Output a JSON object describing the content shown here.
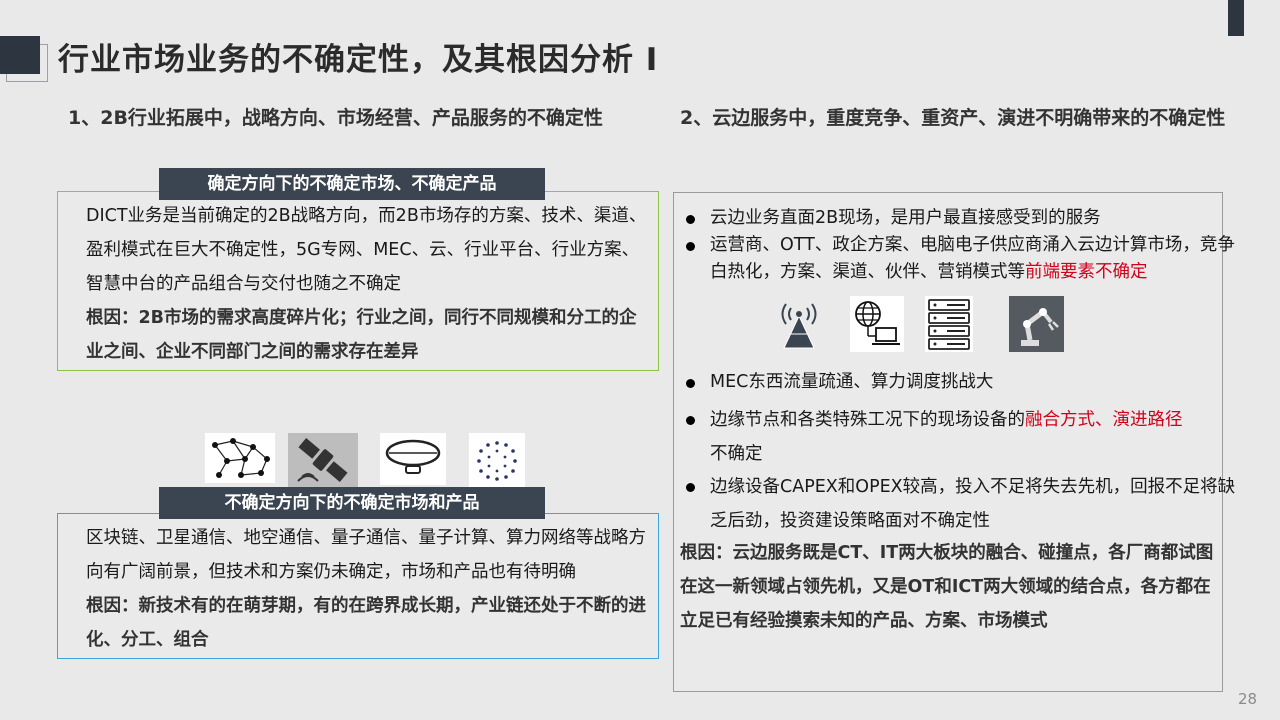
{
  "title": "行业市场业务的不确定性，及其根因分析 I",
  "left": {
    "heading": "1、2B行业拓展中，战略方向、市场经营、产品服务的不确定性",
    "section1": {
      "banner": "确定方向下的不确定市场、不确定产品",
      "body": "DICT业务是当前确定的2B战略方向，而2B市场存的方案、技术、渠道、盈利模式在巨大不确定性，5G专网、MEC、云、行业平台、行业方案、智慧中台的产品组合与交付也随之不确定",
      "root": "根因：2B市场的需求高度碎片化；行业之间，同行不同规模和分工的企业之间、企业不同部门之间的需求存在差异"
    },
    "icons": [
      "network-graph-icon",
      "satellite-icon",
      "airship-icon",
      "quantum-dots-icon"
    ],
    "section2": {
      "banner": "不确定方向下的不确定市场和产品",
      "body": "区块链、卫星通信、地空通信、量子通信、量子计算、算力网络等战略方向有广阔前景，但技术和方案仍未确定，市场和产品也有待明确",
      "root": "根因：新技术有的在萌芽期，有的在跨界成长期，产业链还处于不断的进化、分工、组合"
    }
  },
  "right": {
    "heading": "2、云边服务中，重度竞争、重资产、演进不明确带来的不确定性",
    "bullets_top": [
      {
        "text": "云边业务直面2B现场，是用户最直接感受到的服务",
        "red": ""
      },
      {
        "text": "运营商、OTT、政企方案、电脑电子供应商涌入云边计算市场，竞争白热化，方案、渠道、伙伴、营销模式等",
        "red": "前端要素不确定"
      }
    ],
    "icons": [
      "signal-tower-icon",
      "globe-computer-icon",
      "server-rack-icon",
      "robot-arm-icon"
    ],
    "bullets_bottom": [
      {
        "text": "MEC东西流量疏通、算力调度挑战大"
      },
      {
        "pre": "边缘节点和各类特殊工况下的现场设备的",
        "red": "融合方式、演进路径",
        "post": "不确定"
      },
      {
        "text": "边缘设备CAPEX和OPEX较高，投入不足将失去先机，回报不足将缺乏后劲，投资建设策略面对不确定性"
      }
    ],
    "root": "根因：云边服务既是CT、IT两大板块的融合、碰撞点，各厂商都试图在这一新领域占领先机，又是OT和ICT两大领域的结合点，各方都在立足已有经验摸索未知的产品、方案、市场模式"
  },
  "page_number": "28",
  "colors": {
    "banner": "#3b4552",
    "green_border": "#8cc34a",
    "blue_border": "#3aa6e0",
    "gray_border": "#9a9a9a",
    "accent_red": "#d0021b"
  }
}
